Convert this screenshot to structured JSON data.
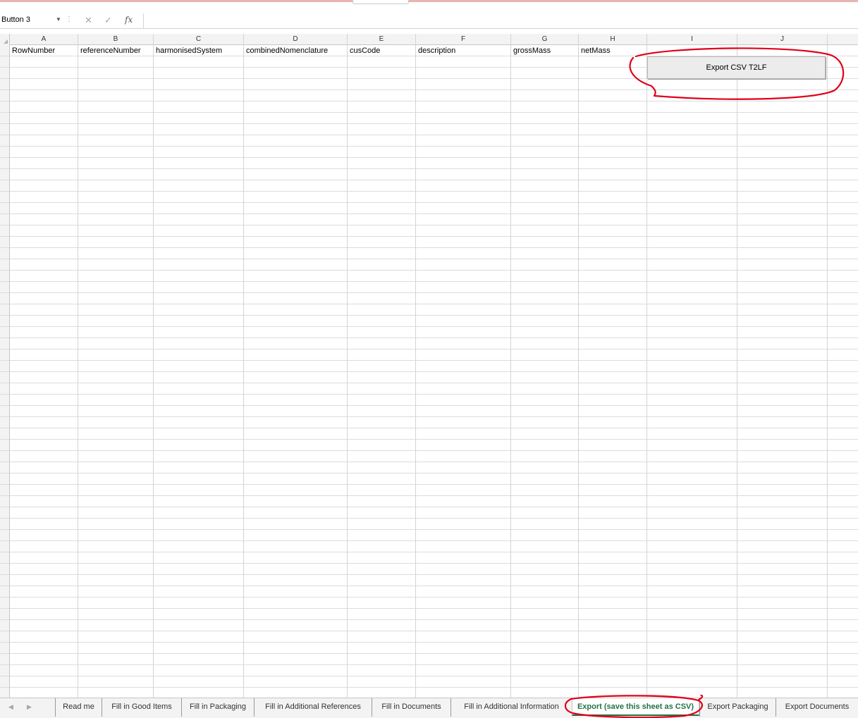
{
  "formula_bar": {
    "name_box": "Button 3",
    "formula": ""
  },
  "columns": [
    "A",
    "B",
    "C",
    "D",
    "E",
    "F",
    "G",
    "H",
    "I",
    "J"
  ],
  "header_row": [
    "RowNumber",
    "referenceNumber",
    "harmonisedSystem",
    "combinedNomenclature",
    "cusCode",
    "description",
    "grossMass",
    "netMass"
  ],
  "row_numbers": [
    "",
    "",
    "",
    "",
    "",
    "",
    "",
    "",
    "",
    "",
    "",
    "",
    "",
    "",
    "",
    "",
    "",
    "",
    "",
    "",
    "",
    "",
    "",
    "",
    "",
    "",
    "",
    "",
    "",
    "",
    "",
    "",
    "",
    "",
    "",
    "",
    "",
    "",
    "",
    "",
    "",
    "",
    "",
    "",
    "",
    "",
    "",
    "",
    "",
    "",
    "",
    "",
    "",
    "",
    "",
    "",
    "",
    "",
    ""
  ],
  "export_button": {
    "label": "Export CSV T2LF"
  },
  "sheet_tabs": [
    {
      "label": "Read me"
    },
    {
      "label": "Fill in Good Items"
    },
    {
      "label": "Fill in Packaging"
    },
    {
      "label": "Fill in Additional References"
    },
    {
      "label": "Fill in Documents"
    },
    {
      "label": "Fill in Additional Information"
    },
    {
      "label": "Export (save this sheet as CSV)",
      "active": true
    },
    {
      "label": "Export Packaging"
    },
    {
      "label": "Export Documents"
    }
  ],
  "colors": {
    "active_tab": "#217346",
    "annotation": "#e0001a",
    "grid_line": "#dcdcdc"
  },
  "icons": {
    "cancel": "cancel-icon",
    "enter": "enter-icon",
    "function": "fx-icon",
    "name_box_dropdown": "chevron-down-icon",
    "sheet_prev": "chevron-left-icon",
    "sheet_next": "chevron-right-icon"
  }
}
